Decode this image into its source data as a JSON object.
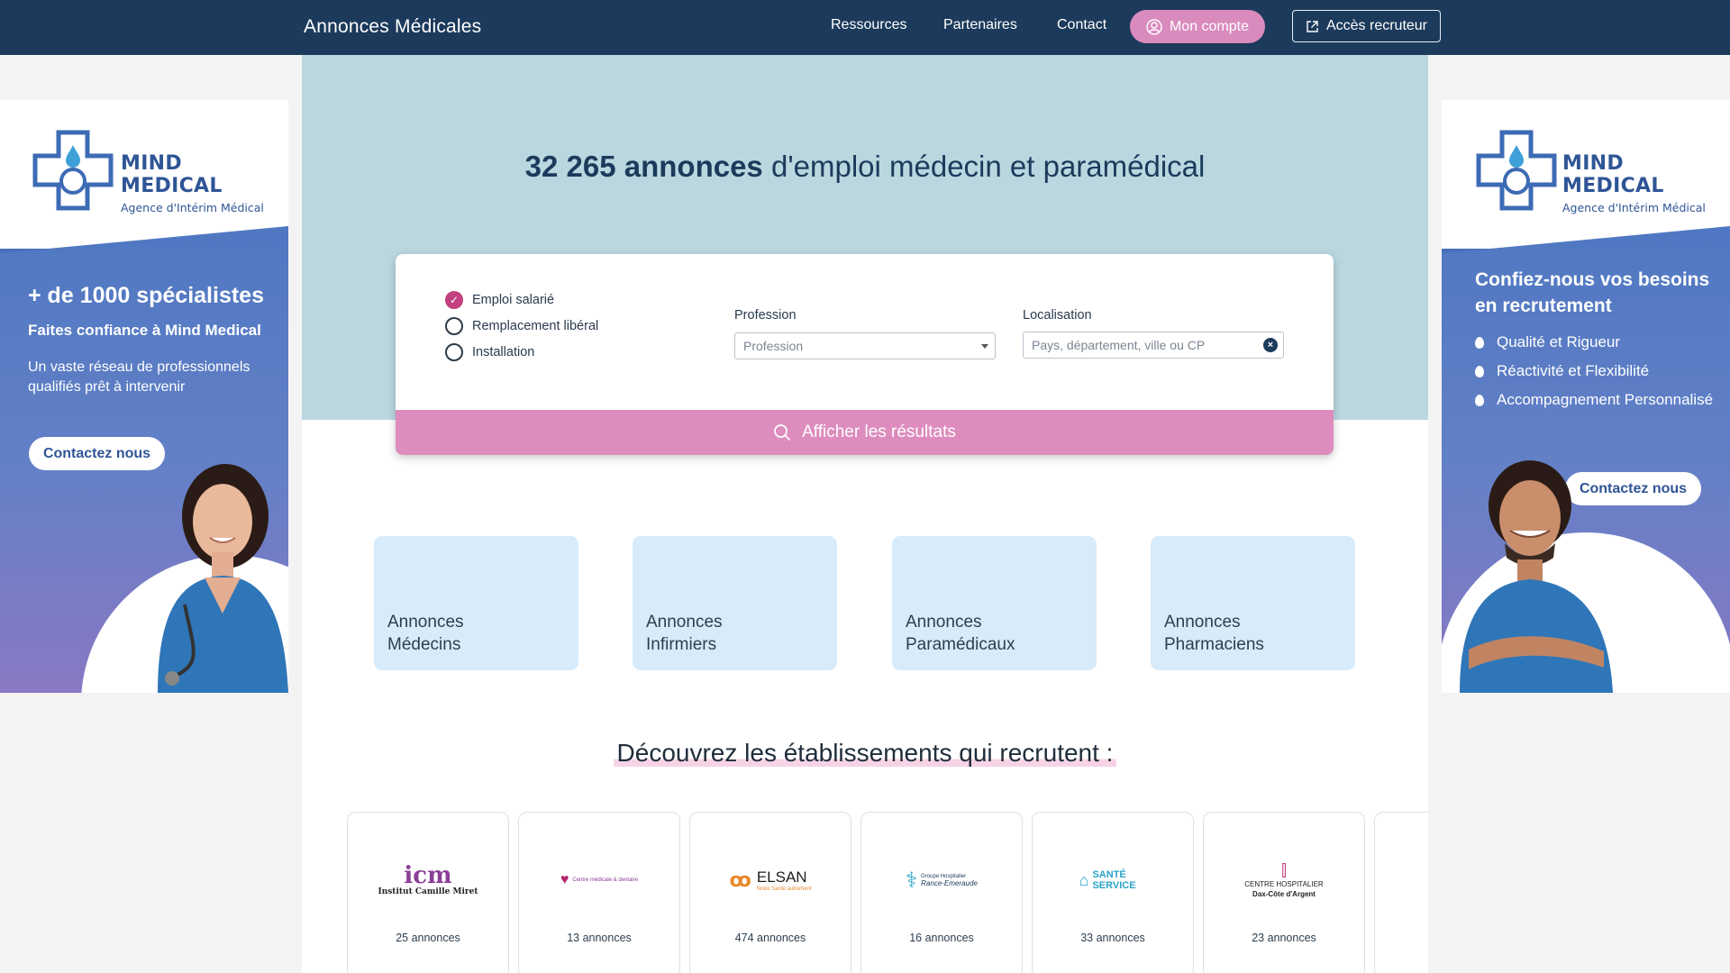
{
  "header": {
    "brand": "Annonces Médicales",
    "nav": [
      "Ressources",
      "Partenaires",
      "Contact"
    ],
    "account_button": "Mon compte",
    "recruiter_button": "Accès recruteur"
  },
  "hero": {
    "count": "32 265 annonces",
    "title_rest": " d'emploi médecin et paramédical"
  },
  "search": {
    "types": [
      {
        "label": "Emploi salarié",
        "checked": true
      },
      {
        "label": "Remplacement libéral",
        "checked": false
      },
      {
        "label": "Installation",
        "checked": false
      }
    ],
    "profession_label": "Profession",
    "profession_value": "Profession",
    "location_label": "Localisation",
    "location_placeholder": "Pays, département, ville ou CP",
    "submit_label": "Afficher les résultats"
  },
  "categories": [
    {
      "label": "Annonces\nMédecins"
    },
    {
      "label": "Annonces\nInfirmiers"
    },
    {
      "label": "Annonces\nParamédicaux"
    },
    {
      "label": "Annonces\nPharmaciens"
    }
  ],
  "establishments": {
    "title": "Découvrez les établissements qui recrutent :",
    "items": [
      {
        "logo_text": "icm",
        "logo_sub": "Institut Camille Miret",
        "count": "25 annonces"
      },
      {
        "logo_text": "",
        "logo_sub": "Centre médicale & dentaire",
        "count": "13 annonces"
      },
      {
        "logo_text": "ELSAN",
        "logo_sub": "Notre Santé autrement",
        "count": "474 annonces"
      },
      {
        "logo_text": "Rance-Emeraude",
        "logo_sub": "Groupe Hospitalier",
        "count": "16 annonces"
      },
      {
        "logo_text": "SANTÉ SERVICE",
        "logo_sub": "",
        "count": "33 annonces"
      },
      {
        "logo_text": "CENTRE HOSPITALIER",
        "logo_sub": "Dax-Côte d'Argent",
        "count": "23 annonces"
      }
    ]
  },
  "ads": {
    "left": {
      "logo_title": "MIND MEDICAL",
      "logo_sub": "Agence d'Intérim Médical",
      "headline": "+ de 1000 spécialistes",
      "subheadline": "Faites confiance à Mind Medical",
      "text": "Un vaste réseau de professionnels qualifiés prêt à intervenir",
      "cta": "Contactez nous"
    },
    "right": {
      "logo_title": "MIND MEDICAL",
      "logo_sub": "Agence d'Intérim Médical",
      "headline": "Confiez-nous vos besoins en recrutement",
      "bullets": [
        "Qualité et Rigueur",
        "Réactivité et Flexibilité",
        "Accompagnement Personnalisé"
      ],
      "cta": "Contactez nous"
    }
  },
  "colors": {
    "navy": "#1c3a5b",
    "pink": "#dd8cbd",
    "hero": "#bad7e0",
    "card": "#d8ebfa"
  }
}
